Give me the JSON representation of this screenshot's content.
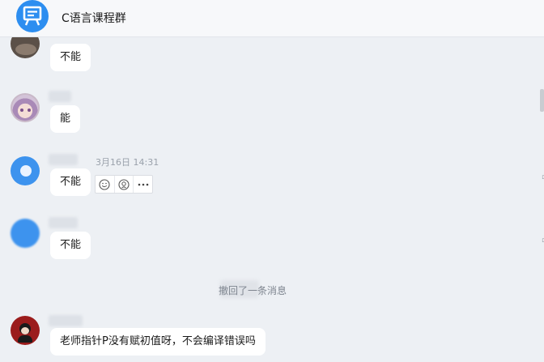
{
  "header": {
    "group_name": "C语言课程群"
  },
  "messages": [
    {
      "text": "不能"
    },
    {
      "text": "能"
    },
    {
      "text": "不能",
      "time": "3月16日  14:31"
    },
    {
      "text": "不能"
    },
    {
      "text": "老师指针P没有赋初值呀，不会编译错误吗"
    }
  ],
  "system": {
    "recall_text": "撤回了一条消息"
  },
  "icons": {
    "group_avatar": "board-icon",
    "actions": [
      "smile-icon",
      "emoji-icon",
      "more-icon"
    ]
  },
  "colors": {
    "accent": "#2d8ef0",
    "background": "#edf0f4",
    "bubble": "#ffffff"
  }
}
